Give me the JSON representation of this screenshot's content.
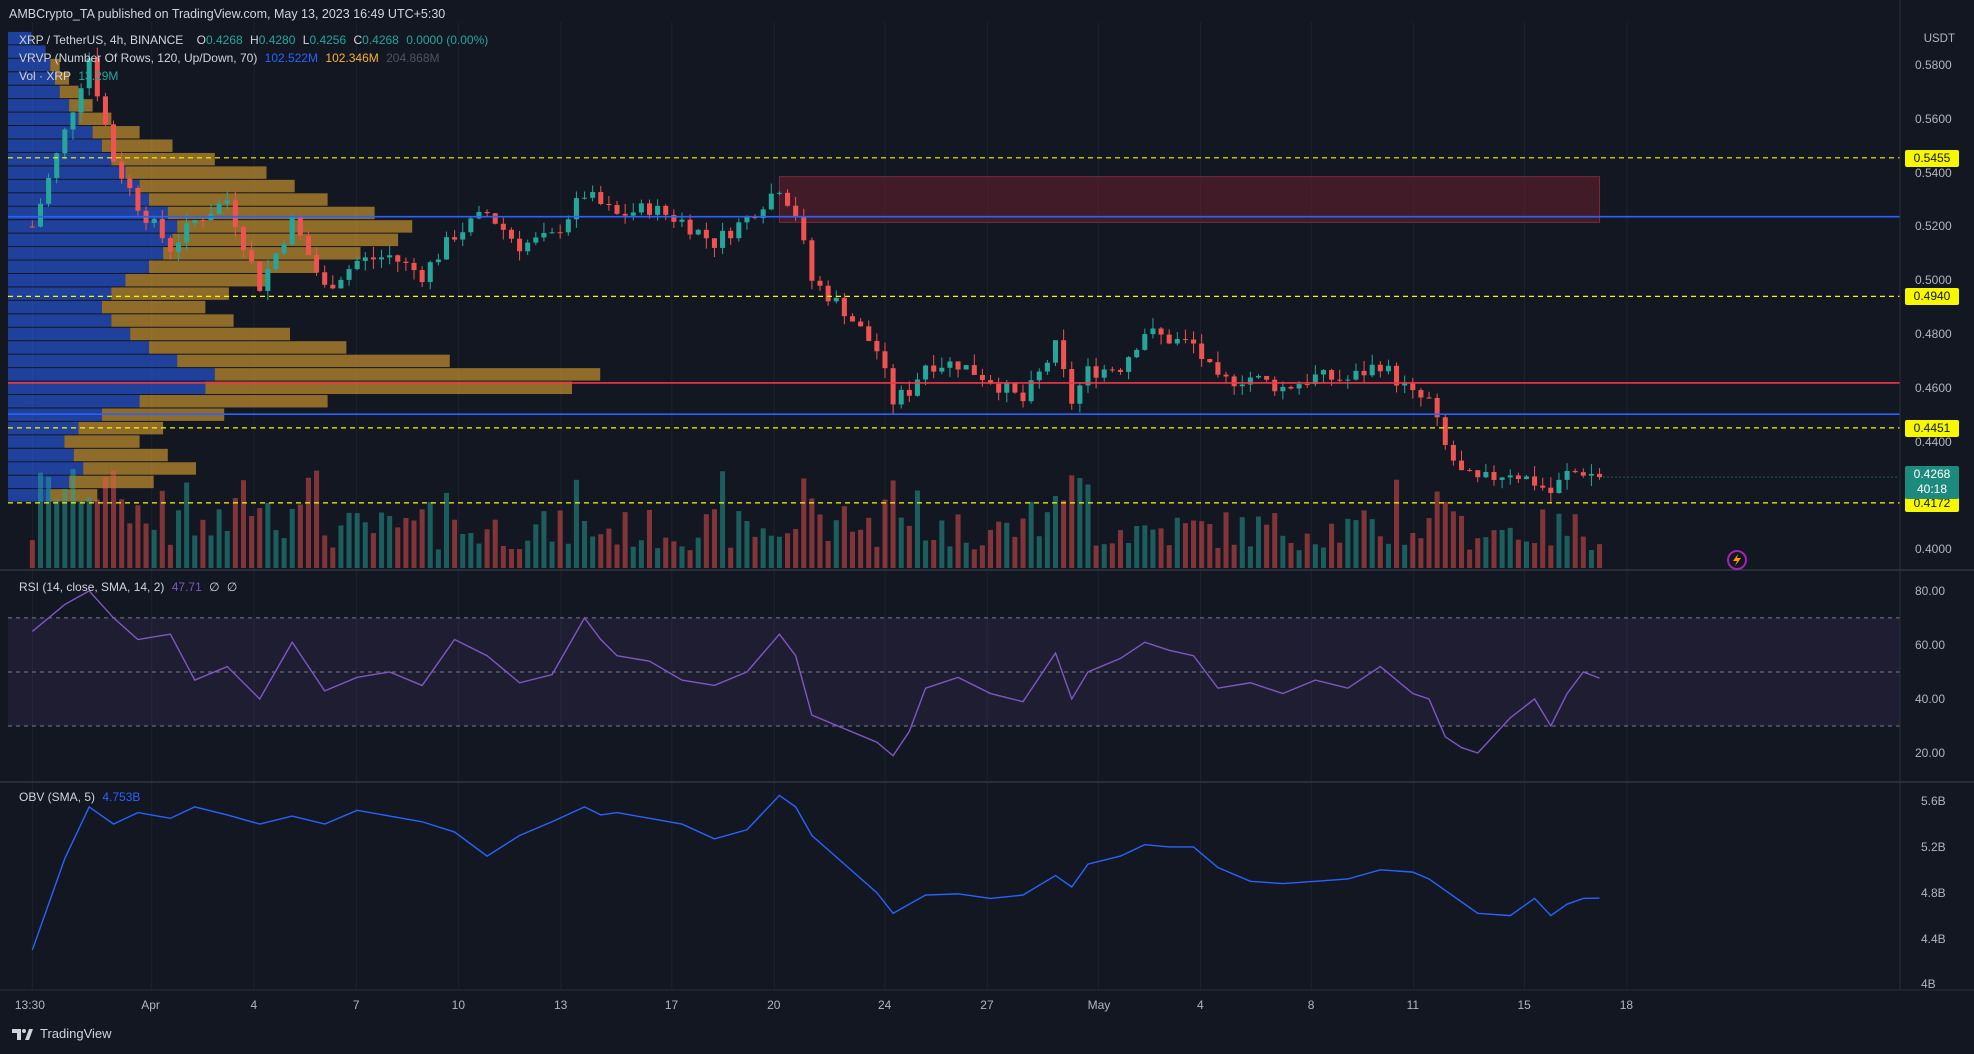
{
  "header": {
    "publisher": "AMBCrypto_TA published on TradingView.com, May 13, 2023 16:49 UTC+5:30"
  },
  "legend": {
    "symbol": "XRP / TetherUS, 4h, BINANCE",
    "open_label": "O",
    "open": "0.4268",
    "high_label": "H",
    "high": "0.4280",
    "low_label": "L",
    "low": "0.4256",
    "close_label": "C",
    "close": "0.4268",
    "change": "0.0000 (0.00%)",
    "vrvp_label": "VRVP (Number Of Rows, 120, Up/Down, 70)",
    "vrvp_up": "102.522M",
    "vrvp_down": "102.346M",
    "vrvp_total": "204.868M",
    "vol_label": "Vol · XRP",
    "vol_value": "13.29M",
    "rsi_label": "RSI (14, close, SMA, 14, 2)",
    "rsi_value": "47.71",
    "rsi_na1": "∅",
    "rsi_na2": "∅",
    "obv_label": "OBV (SMA, 5)",
    "obv_value": "4.753B"
  },
  "price_axis": {
    "currency": "USDT",
    "ticks": [
      "0.5800",
      "0.5600",
      "0.5400",
      "0.5200",
      "0.5000",
      "0.4800",
      "0.4600",
      "0.4400",
      "0.4000"
    ],
    "level_tags": [
      "0.5455",
      "0.4940",
      "0.4451",
      "0.4172"
    ],
    "current_price": "0.4268",
    "countdown": "40:18"
  },
  "rsi_axis": {
    "ticks": [
      "80.00",
      "60.00",
      "40.00",
      "20.00"
    ]
  },
  "obv_axis": {
    "ticks": [
      "5.6B",
      "5.2B",
      "4.8B",
      "4.4B",
      "4B"
    ]
  },
  "time_axis": {
    "ticks": [
      "13:30",
      "Apr",
      "4",
      "7",
      "10",
      "13",
      "17",
      "20",
      "24",
      "27",
      "May",
      "4",
      "8",
      "11",
      "15",
      "18"
    ]
  },
  "footer": {
    "brand": "TradingView"
  },
  "colors": {
    "background": "#131722",
    "up": "#26a69a",
    "down": "#ef5350",
    "support_yellow": "#f7f700",
    "blue_line": "#2962ff",
    "red_line": "#f23645",
    "rsi_line": "#7e57c2",
    "obv_line": "#2962ff"
  },
  "chart_data": {
    "type": "candlestick",
    "symbol": "XRP / TetherUS",
    "interval": "4h",
    "ylim": [
      0.393,
      0.596
    ],
    "horizontal_levels": [
      {
        "value": 0.5455,
        "style": "dashed",
        "color": "#f7f700"
      },
      {
        "value": 0.5236,
        "style": "solid",
        "color": "#2962ff"
      },
      {
        "value": 0.494,
        "style": "dashed",
        "color": "#f7f700"
      },
      {
        "value": 0.4618,
        "style": "solid",
        "color": "#f23645"
      },
      {
        "value": 0.4502,
        "style": "solid",
        "color": "#2962ff"
      },
      {
        "value": 0.4451,
        "style": "dashed",
        "color": "#f7f700"
      },
      {
        "value": 0.4172,
        "style": "dashed",
        "color": "#f7f700"
      }
    ],
    "supply_zone": {
      "x_start": "Apr 19",
      "x_end": "May 13",
      "low": 0.5215,
      "high": 0.5385
    },
    "price_path": [
      {
        "x": 0,
        "y": 0.52
      },
      {
        "x": 4,
        "y": 0.555
      },
      {
        "x": 7,
        "y": 0.583
      },
      {
        "x": 10,
        "y": 0.545
      },
      {
        "x": 13,
        "y": 0.528
      },
      {
        "x": 17,
        "y": 0.512
      },
      {
        "x": 20,
        "y": 0.522
      },
      {
        "x": 24,
        "y": 0.53
      },
      {
        "x": 28,
        "y": 0.498
      },
      {
        "x": 32,
        "y": 0.522
      },
      {
        "x": 36,
        "y": 0.497
      },
      {
        "x": 40,
        "y": 0.507
      },
      {
        "x": 44,
        "y": 0.509
      },
      {
        "x": 48,
        "y": 0.502
      },
      {
        "x": 52,
        "y": 0.517
      },
      {
        "x": 56,
        "y": 0.525
      },
      {
        "x": 60,
        "y": 0.513
      },
      {
        "x": 64,
        "y": 0.516
      },
      {
        "x": 68,
        "y": 0.532
      },
      {
        "x": 72,
        "y": 0.524
      },
      {
        "x": 76,
        "y": 0.527
      },
      {
        "x": 80,
        "y": 0.522
      },
      {
        "x": 84,
        "y": 0.514
      },
      {
        "x": 88,
        "y": 0.523
      },
      {
        "x": 92,
        "y": 0.535
      },
      {
        "x": 94,
        "y": 0.525
      },
      {
        "x": 96,
        "y": 0.5
      },
      {
        "x": 100,
        "y": 0.489
      },
      {
        "x": 104,
        "y": 0.474
      },
      {
        "x": 106,
        "y": 0.455
      },
      {
        "x": 108,
        "y": 0.459
      },
      {
        "x": 110,
        "y": 0.469
      },
      {
        "x": 114,
        "y": 0.469
      },
      {
        "x": 118,
        "y": 0.463
      },
      {
        "x": 122,
        "y": 0.455
      },
      {
        "x": 126,
        "y": 0.475
      },
      {
        "x": 128,
        "y": 0.455
      },
      {
        "x": 130,
        "y": 0.466
      },
      {
        "x": 134,
        "y": 0.468
      },
      {
        "x": 137,
        "y": 0.481
      },
      {
        "x": 140,
        "y": 0.478
      },
      {
        "x": 143,
        "y": 0.476
      },
      {
        "x": 146,
        "y": 0.462
      },
      {
        "x": 150,
        "y": 0.464
      },
      {
        "x": 154,
        "y": 0.46
      },
      {
        "x": 158,
        "y": 0.464
      },
      {
        "x": 162,
        "y": 0.463
      },
      {
        "x": 166,
        "y": 0.469
      },
      {
        "x": 170,
        "y": 0.457
      },
      {
        "x": 172,
        "y": 0.455
      },
      {
        "x": 174,
        "y": 0.438
      },
      {
        "x": 176,
        "y": 0.428
      },
      {
        "x": 178,
        "y": 0.425
      },
      {
        "x": 182,
        "y": 0.429
      },
      {
        "x": 185,
        "y": 0.425
      },
      {
        "x": 187,
        "y": 0.421
      },
      {
        "x": 189,
        "y": 0.428
      },
      {
        "x": 191,
        "y": 0.429
      },
      {
        "x": 193,
        "y": 0.4268
      }
    ],
    "rsi": {
      "ylim": [
        10,
        87
      ],
      "bands": [
        70,
        50,
        30
      ],
      "values": [
        {
          "x": 0,
          "y": 65
        },
        {
          "x": 4,
          "y": 75
        },
        {
          "x": 7,
          "y": 80
        },
        {
          "x": 10,
          "y": 70
        },
        {
          "x": 13,
          "y": 62
        },
        {
          "x": 17,
          "y": 64
        },
        {
          "x": 20,
          "y": 47
        },
        {
          "x": 24,
          "y": 52
        },
        {
          "x": 28,
          "y": 40
        },
        {
          "x": 32,
          "y": 61
        },
        {
          "x": 36,
          "y": 43
        },
        {
          "x": 40,
          "y": 48
        },
        {
          "x": 44,
          "y": 50
        },
        {
          "x": 48,
          "y": 45
        },
        {
          "x": 52,
          "y": 62
        },
        {
          "x": 56,
          "y": 56
        },
        {
          "x": 60,
          "y": 46
        },
        {
          "x": 64,
          "y": 49
        },
        {
          "x": 68,
          "y": 70
        },
        {
          "x": 70,
          "y": 62
        },
        {
          "x": 72,
          "y": 56
        },
        {
          "x": 76,
          "y": 54
        },
        {
          "x": 80,
          "y": 47
        },
        {
          "x": 84,
          "y": 45
        },
        {
          "x": 88,
          "y": 50
        },
        {
          "x": 92,
          "y": 64
        },
        {
          "x": 94,
          "y": 56
        },
        {
          "x": 96,
          "y": 34
        },
        {
          "x": 100,
          "y": 29
        },
        {
          "x": 104,
          "y": 24
        },
        {
          "x": 106,
          "y": 19
        },
        {
          "x": 108,
          "y": 28
        },
        {
          "x": 110,
          "y": 44
        },
        {
          "x": 114,
          "y": 48
        },
        {
          "x": 118,
          "y": 42
        },
        {
          "x": 122,
          "y": 39
        },
        {
          "x": 126,
          "y": 57
        },
        {
          "x": 128,
          "y": 40
        },
        {
          "x": 130,
          "y": 50
        },
        {
          "x": 134,
          "y": 55
        },
        {
          "x": 137,
          "y": 61
        },
        {
          "x": 140,
          "y": 58
        },
        {
          "x": 143,
          "y": 56
        },
        {
          "x": 146,
          "y": 44
        },
        {
          "x": 150,
          "y": 46
        },
        {
          "x": 154,
          "y": 42
        },
        {
          "x": 158,
          "y": 47
        },
        {
          "x": 162,
          "y": 44
        },
        {
          "x": 166,
          "y": 52
        },
        {
          "x": 170,
          "y": 42
        },
        {
          "x": 172,
          "y": 40
        },
        {
          "x": 174,
          "y": 26
        },
        {
          "x": 176,
          "y": 22
        },
        {
          "x": 178,
          "y": 20
        },
        {
          "x": 182,
          "y": 33
        },
        {
          "x": 185,
          "y": 40
        },
        {
          "x": 187,
          "y": 30
        },
        {
          "x": 189,
          "y": 42
        },
        {
          "x": 191,
          "y": 50
        },
        {
          "x": 193,
          "y": 47.71
        }
      ]
    },
    "obv": {
      "ylim": [
        3.95,
        5.75
      ],
      "values": [
        {
          "x": 0,
          "y": 4.3
        },
        {
          "x": 4,
          "y": 5.1
        },
        {
          "x": 7,
          "y": 5.55
        },
        {
          "x": 10,
          "y": 5.4
        },
        {
          "x": 13,
          "y": 5.5
        },
        {
          "x": 17,
          "y": 5.45
        },
        {
          "x": 20,
          "y": 5.55
        },
        {
          "x": 24,
          "y": 5.48
        },
        {
          "x": 28,
          "y": 5.4
        },
        {
          "x": 32,
          "y": 5.47
        },
        {
          "x": 36,
          "y": 5.4
        },
        {
          "x": 40,
          "y": 5.52
        },
        {
          "x": 44,
          "y": 5.47
        },
        {
          "x": 48,
          "y": 5.42
        },
        {
          "x": 52,
          "y": 5.33
        },
        {
          "x": 56,
          "y": 5.12
        },
        {
          "x": 60,
          "y": 5.3
        },
        {
          "x": 64,
          "y": 5.42
        },
        {
          "x": 68,
          "y": 5.55
        },
        {
          "x": 70,
          "y": 5.48
        },
        {
          "x": 72,
          "y": 5.5
        },
        {
          "x": 76,
          "y": 5.45
        },
        {
          "x": 80,
          "y": 5.4
        },
        {
          "x": 84,
          "y": 5.27
        },
        {
          "x": 88,
          "y": 5.35
        },
        {
          "x": 92,
          "y": 5.65
        },
        {
          "x": 94,
          "y": 5.55
        },
        {
          "x": 96,
          "y": 5.3
        },
        {
          "x": 100,
          "y": 5.05
        },
        {
          "x": 104,
          "y": 4.8
        },
        {
          "x": 106,
          "y": 4.62
        },
        {
          "x": 108,
          "y": 4.7
        },
        {
          "x": 110,
          "y": 4.78
        },
        {
          "x": 114,
          "y": 4.79
        },
        {
          "x": 118,
          "y": 4.75
        },
        {
          "x": 122,
          "y": 4.78
        },
        {
          "x": 126,
          "y": 4.95
        },
        {
          "x": 128,
          "y": 4.85
        },
        {
          "x": 130,
          "y": 5.05
        },
        {
          "x": 134,
          "y": 5.12
        },
        {
          "x": 137,
          "y": 5.22
        },
        {
          "x": 140,
          "y": 5.2
        },
        {
          "x": 143,
          "y": 5.2
        },
        {
          "x": 146,
          "y": 5.02
        },
        {
          "x": 150,
          "y": 4.9
        },
        {
          "x": 154,
          "y": 4.88
        },
        {
          "x": 158,
          "y": 4.9
        },
        {
          "x": 162,
          "y": 4.92
        },
        {
          "x": 166,
          "y": 5.0
        },
        {
          "x": 170,
          "y": 4.98
        },
        {
          "x": 172,
          "y": 4.92
        },
        {
          "x": 174,
          "y": 4.82
        },
        {
          "x": 176,
          "y": 4.72
        },
        {
          "x": 178,
          "y": 4.62
        },
        {
          "x": 182,
          "y": 4.6
        },
        {
          "x": 185,
          "y": 4.75
        },
        {
          "x": 187,
          "y": 4.6
        },
        {
          "x": 189,
          "y": 4.7
        },
        {
          "x": 191,
          "y": 4.75
        },
        {
          "x": 193,
          "y": 4.753
        }
      ]
    },
    "volume_profile": {
      "note_values": "relative volume per price row (0-1)",
      "rows": [
        {
          "price": 0.59,
          "up": 0.05,
          "down": 0.0
        },
        {
          "price": 0.585,
          "up": 0.08,
          "down": 0.0
        },
        {
          "price": 0.58,
          "up": 0.09,
          "down": 0.02
        },
        {
          "price": 0.575,
          "up": 0.1,
          "down": 0.03
        },
        {
          "price": 0.57,
          "up": 0.11,
          "down": 0.04
        },
        {
          "price": 0.565,
          "up": 0.13,
          "down": 0.05
        },
        {
          "price": 0.56,
          "up": 0.15,
          "down": 0.07
        },
        {
          "price": 0.555,
          "up": 0.18,
          "down": 0.1
        },
        {
          "price": 0.55,
          "up": 0.2,
          "down": 0.15
        },
        {
          "price": 0.545,
          "up": 0.22,
          "down": 0.22
        },
        {
          "price": 0.54,
          "up": 0.25,
          "down": 0.3
        },
        {
          "price": 0.535,
          "up": 0.28,
          "down": 0.33
        },
        {
          "price": 0.53,
          "up": 0.3,
          "down": 0.38
        },
        {
          "price": 0.525,
          "up": 0.34,
          "down": 0.44
        },
        {
          "price": 0.52,
          "up": 0.36,
          "down": 0.5
        },
        {
          "price": 0.515,
          "up": 0.35,
          "down": 0.48
        },
        {
          "price": 0.51,
          "up": 0.33,
          "down": 0.42
        },
        {
          "price": 0.505,
          "up": 0.3,
          "down": 0.36
        },
        {
          "price": 0.5,
          "up": 0.25,
          "down": 0.3
        },
        {
          "price": 0.495,
          "up": 0.22,
          "down": 0.25
        },
        {
          "price": 0.49,
          "up": 0.2,
          "down": 0.22
        },
        {
          "price": 0.485,
          "up": 0.22,
          "down": 0.26
        },
        {
          "price": 0.48,
          "up": 0.26,
          "down": 0.34
        },
        {
          "price": 0.475,
          "up": 0.3,
          "down": 0.42
        },
        {
          "price": 0.47,
          "up": 0.36,
          "down": 0.58
        },
        {
          "price": 0.465,
          "up": 0.44,
          "down": 0.82
        },
        {
          "price": 0.46,
          "up": 0.42,
          "down": 0.78
        },
        {
          "price": 0.455,
          "up": 0.28,
          "down": 0.4
        },
        {
          "price": 0.45,
          "up": 0.2,
          "down": 0.26
        },
        {
          "price": 0.445,
          "up": 0.15,
          "down": 0.18
        },
        {
          "price": 0.44,
          "up": 0.12,
          "down": 0.16
        },
        {
          "price": 0.435,
          "up": 0.14,
          "down": 0.2
        },
        {
          "price": 0.43,
          "up": 0.16,
          "down": 0.24
        },
        {
          "price": 0.425,
          "up": 0.13,
          "down": 0.18
        },
        {
          "price": 0.42,
          "up": 0.09,
          "down": 0.1
        }
      ]
    }
  }
}
